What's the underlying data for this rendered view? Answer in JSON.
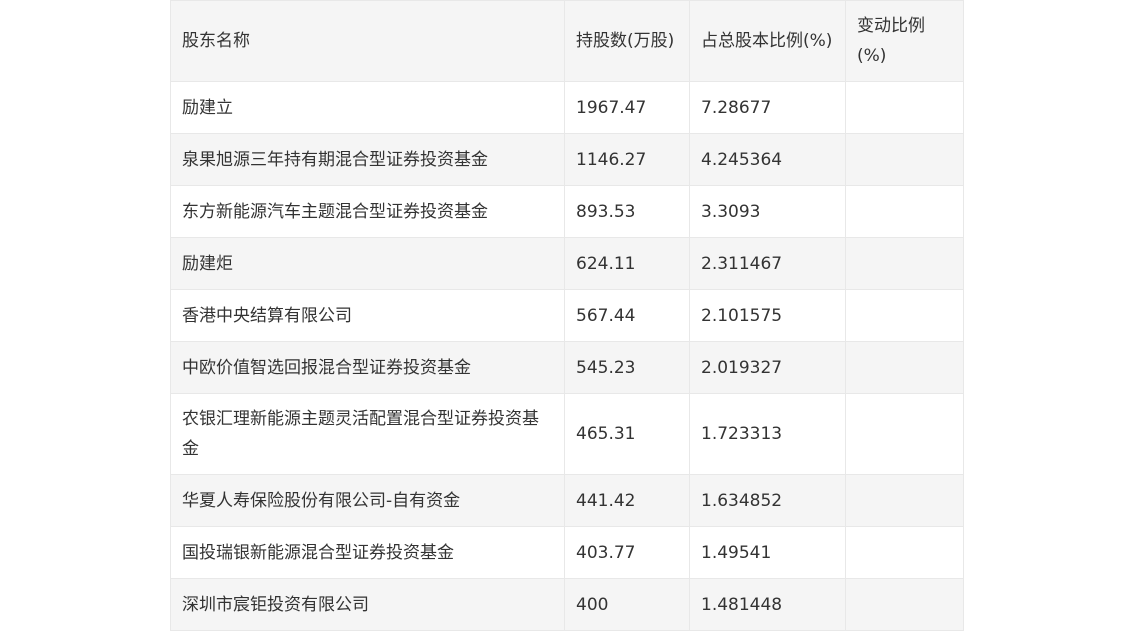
{
  "table": {
    "headers": [
      "股东名称",
      "持股数(万股)",
      "占总股本比例(%)",
      "变动比例(%)"
    ],
    "rows": [
      [
        "励建立",
        "1967.47",
        "7.28677",
        ""
      ],
      [
        "泉果旭源三年持有期混合型证券投资基金",
        "1146.27",
        "4.245364",
        ""
      ],
      [
        "东方新能源汽车主题混合型证券投资基金",
        "893.53",
        "3.3093",
        ""
      ],
      [
        "励建炬",
        "624.11",
        "2.311467",
        ""
      ],
      [
        "香港中央结算有限公司",
        "567.44",
        "2.101575",
        ""
      ],
      [
        "中欧价值智选回报混合型证券投资基金",
        "545.23",
        "2.019327",
        ""
      ],
      [
        "农银汇理新能源主题灵活配置混合型证券投资基金",
        "465.31",
        "1.723313",
        ""
      ],
      [
        "华夏人寿保险股份有限公司-自有资金",
        "441.42",
        "1.634852",
        ""
      ],
      [
        "国投瑞银新能源混合型证券投资基金",
        "403.77",
        "1.49541",
        ""
      ],
      [
        "深圳市宸钜投资有限公司",
        "400",
        "1.481448",
        ""
      ]
    ]
  }
}
